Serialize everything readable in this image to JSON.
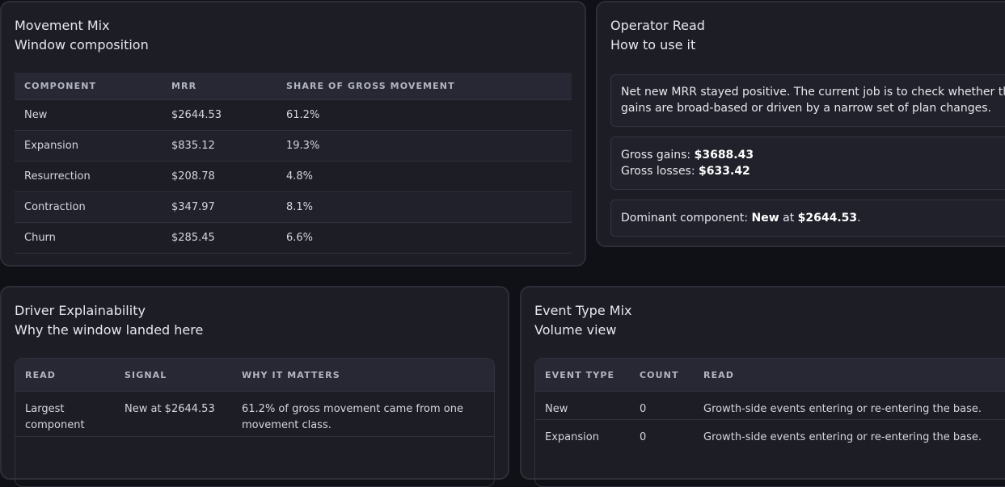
{
  "movement_mix": {
    "title": "Movement Mix",
    "subtitle": "Window composition",
    "columns": [
      "COMPONENT",
      "MRR",
      "SHARE OF GROSS MOVEMENT"
    ],
    "rows": [
      {
        "component": "New",
        "mrr": "$2644.53",
        "share": "61.2%"
      },
      {
        "component": "Expansion",
        "mrr": "$835.12",
        "share": "19.3%"
      },
      {
        "component": "Resurrection",
        "mrr": "$208.78",
        "share": "4.8%"
      },
      {
        "component": "Contraction",
        "mrr": "$347.97",
        "share": "8.1%"
      },
      {
        "component": "Churn",
        "mrr": "$285.45",
        "share": "6.6%"
      }
    ]
  },
  "operator_read": {
    "title": "Operator Read",
    "subtitle": "How to use it",
    "note": "Net new MRR stayed positive. The current job is to check whether the gains are broad-based or driven by a narrow set of plan changes.",
    "gross_gains_label": "Gross gains:",
    "gross_gains_value": "$3688.43",
    "gross_losses_label": "Gross losses:",
    "gross_losses_value": "$633.42",
    "dominant_label": "Dominant component:",
    "dominant_component": "New",
    "dominant_at": "at",
    "dominant_value": "$2644.53",
    "dominant_end": "."
  },
  "driver_explainability": {
    "title": "Driver Explainability",
    "subtitle": "Why the window landed here",
    "columns": [
      "READ",
      "SIGNAL",
      "WHY IT MATTERS"
    ],
    "rows": [
      {
        "read": "Largest component",
        "signal": "New at $2644.53",
        "why": "61.2% of gross movement came from one movement class."
      }
    ]
  },
  "event_type_mix": {
    "title": "Event Type Mix",
    "subtitle": "Volume view",
    "columns": [
      "EVENT TYPE",
      "COUNT",
      "READ"
    ],
    "rows": [
      {
        "type": "New",
        "count": "0",
        "read": "Growth-side events entering or re-entering the base."
      },
      {
        "type": "Expansion",
        "count": "0",
        "read": "Growth-side events entering or re-entering the base."
      }
    ]
  }
}
